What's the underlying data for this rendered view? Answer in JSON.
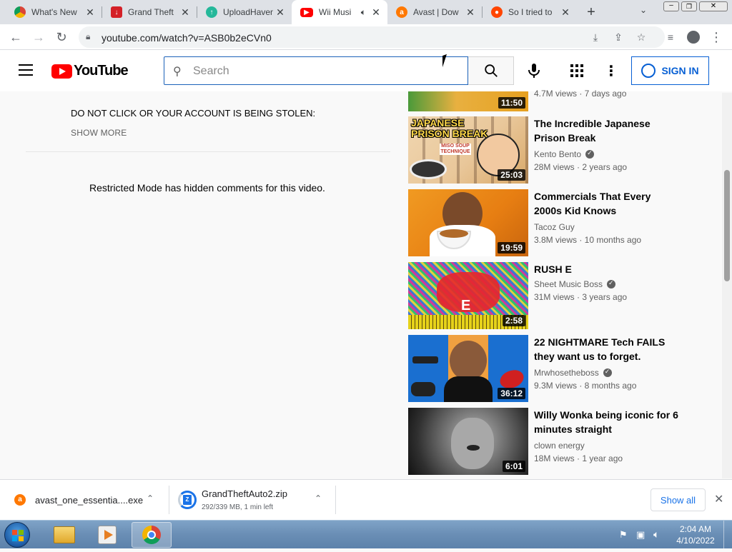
{
  "browser": {
    "tabs": [
      {
        "title": "What's New",
        "favicon": "chrome-icon",
        "active": false
      },
      {
        "title": "Grand Theft",
        "favicon": "download-site-icon",
        "active": false
      },
      {
        "title": "UploadHaven",
        "favicon": "uploadhaven-icon",
        "active": false
      },
      {
        "title": "Wii Musi",
        "favicon": "youtube-icon",
        "active": true
      },
      {
        "title": "Avast | Dow",
        "favicon": "avast-icon",
        "active": false
      },
      {
        "title": "So I tried to",
        "favicon": "reddit-icon",
        "active": false
      }
    ],
    "new_tab": "+",
    "url": "youtube.com/watch?v=ASB0b2eCVn0"
  },
  "youtube": {
    "logo_text": "YouTube",
    "search_placeholder": "Search",
    "signin_label": "SIGN IN"
  },
  "main": {
    "description": "DO NOT CLICK OR YOUR ACCOUNT IS BEING STOLEN:",
    "show_more": "SHOW MORE",
    "restricted_message": "Restricted Mode has hidden comments for this video."
  },
  "recommendations": {
    "partial": {
      "meta": "4.7M views · 7 days ago",
      "duration": "11:50"
    },
    "items": [
      {
        "title": "The Incredible Japanese Prison Break",
        "channel": "Kento Bento",
        "verified": true,
        "meta": "28M views · 2 years ago",
        "duration": "25:03",
        "thumb_text": "JAPANESE PRISON BREAK",
        "thumb_sub": "MISO SOUP TECHNIQUE"
      },
      {
        "title": "Commercials That Every 2000s Kid Knows",
        "channel": "Tacoz Guy",
        "verified": false,
        "meta": "3.8M views · 10 months ago",
        "duration": "19:59"
      },
      {
        "title": "RUSH E",
        "channel": "Sheet Music Boss",
        "verified": true,
        "meta": "31M views · 3 years ago",
        "duration": "2:58",
        "thumb_text": "E"
      },
      {
        "title": "22 NIGHTMARE Tech FAILS they want us to forget.",
        "channel": "Mrwhosetheboss",
        "verified": true,
        "meta": "9.3M views · 8 months ago",
        "duration": "36:12"
      },
      {
        "title": "Willy Wonka being iconic for 6 minutes straight",
        "channel": "clown energy",
        "verified": false,
        "meta": "18M views · 1 year ago",
        "duration": "6:01"
      }
    ]
  },
  "downloads": {
    "items": [
      {
        "name": "avast_one_essentia....exe",
        "status": ""
      },
      {
        "name": "GrandTheftAuto2.zip",
        "status": "292/339 MB, 1 min left",
        "progress": 0.86
      }
    ],
    "show_all": "Show all"
  },
  "taskbar": {
    "time": "2:04 AM",
    "date": "4/10/2022"
  }
}
